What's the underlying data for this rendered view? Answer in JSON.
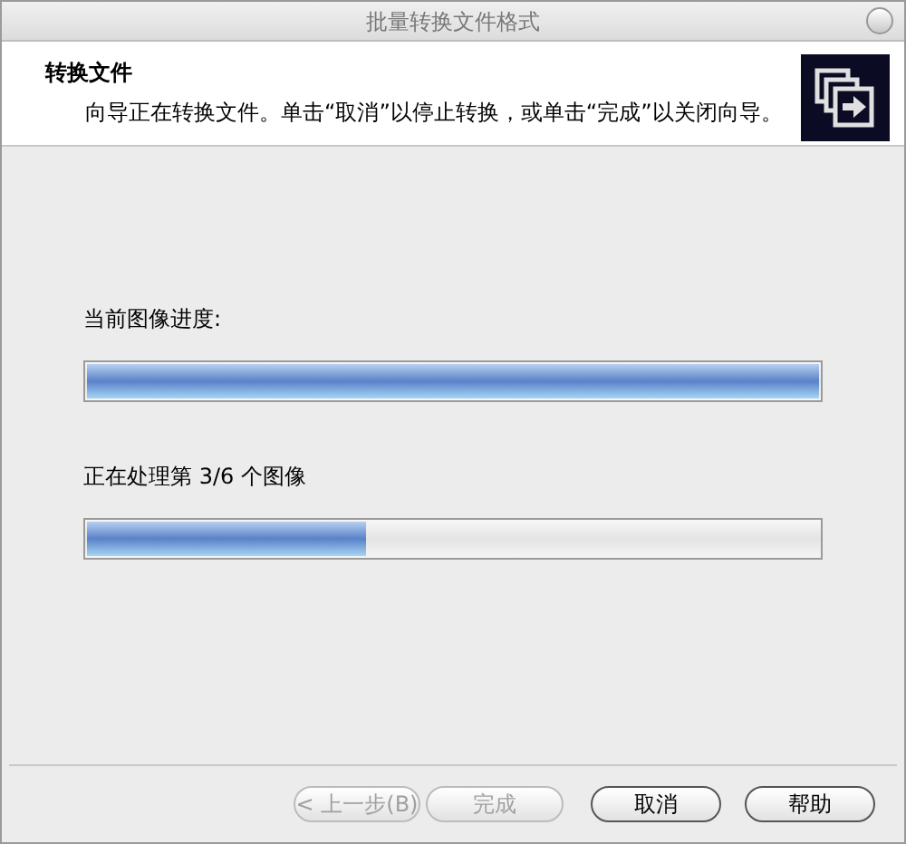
{
  "window": {
    "title": "批量转换文件格式"
  },
  "header": {
    "title": "转换文件",
    "description": "向导正在转换文件。单击“取消”以停止转换，或单击“完成”以关闭向导。"
  },
  "progress": [
    {
      "label": "当前图像进度:",
      "level": 1.0
    },
    {
      "label": "正在处理第 3/6 个图像",
      "level": 0.38
    }
  ],
  "buttons": [
    {
      "label": "< 上一步(B)",
      "disabled": true
    },
    {
      "label": "完成",
      "disabled": true
    },
    {
      "label": "取消",
      "disabled": false
    },
    {
      "label": "帮助",
      "disabled": false
    }
  ]
}
